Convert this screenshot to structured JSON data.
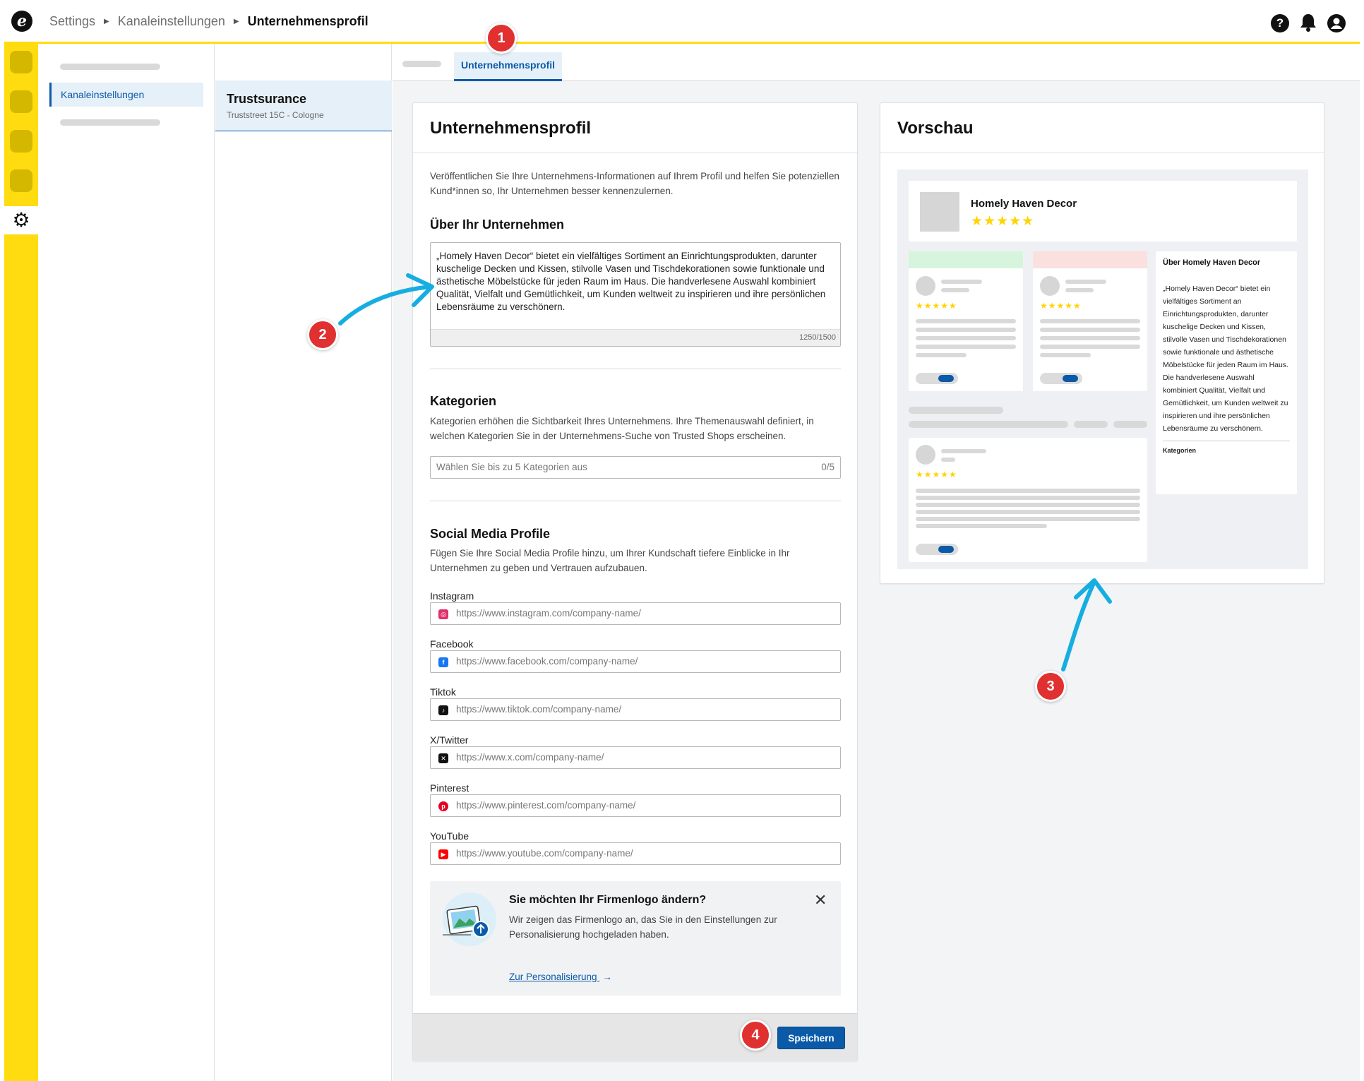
{
  "breadcrumb": {
    "root": "Settings",
    "section": "Kanaleinstellungen",
    "current": "Unternehmensprofil"
  },
  "topbar": {
    "help_icon": "question-circle-icon",
    "bell_icon": "bell-icon",
    "user_icon": "user-circle-icon"
  },
  "nav": {
    "active_item": "Kanaleinstellungen"
  },
  "channel": {
    "name": "Trustsurance",
    "address": "Truststreet 15C - Cologne"
  },
  "tabs": {
    "active": "Unternehmensprofil"
  },
  "form": {
    "title": "Unternehmensprofil",
    "intro": "Veröffentlichen Sie Ihre Unternehmens-Informationen auf Ihrem Profil und helfen Sie potenziellen Kund*innen so, Ihr Unternehmen besser kennenzulernen.",
    "about_heading": "Über Ihr Unternehmen",
    "about_text": "„Homely Haven Decor“ bietet ein vielfältiges Sortiment an Einrichtungsprodukten, darunter kuschelige Decken und Kissen, stilvolle Vasen und Tischdekorationen sowie funktionale und ästhetische Möbelstücke für jeden Raum im Haus. Die handverlesene Auswahl kombiniert Qualität, Vielfalt und Gemütlichkeit, um Kunden weltweit zu inspirieren und ihre persönlichen Lebensräume zu verschönern.",
    "about_counter": "1250/1500",
    "categories_heading": "Kategorien",
    "categories_desc": "Kategorien erhöhen die Sichtbarkeit Ihres Unternehmens. Ihre Themenauswahl definiert, in welchen Kategorien Sie in der Unternehmens-Suche von Trusted Shops erscheinen.",
    "categories_placeholder": "Wählen Sie bis zu 5 Kategorien aus",
    "categories_counter": "0/5",
    "social_heading": "Social Media Profile",
    "social_desc": "Fügen Sie Ihre Social Media Profile hinzu, um Ihrer Kundschaft tiefere Einblicke in Ihr Unternehmen zu geben und Vertrauen aufzubauen.",
    "social": [
      {
        "label": "Instagram",
        "placeholder": "https://www.instagram.com/company-name/",
        "icon": "instagram-icon",
        "color": "#e1306c"
      },
      {
        "label": "Facebook",
        "placeholder": "https://www.facebook.com/company-name/",
        "icon": "facebook-icon",
        "color": "#1877f2"
      },
      {
        "label": "Tiktok",
        "placeholder": "https://www.tiktok.com/company-name/",
        "icon": "tiktok-icon",
        "color": "#111111"
      },
      {
        "label": "X/Twitter",
        "placeholder": "https://www.x.com/company-name/",
        "icon": "x-icon",
        "color": "#111111"
      },
      {
        "label": "Pinterest",
        "placeholder": "https://www.pinterest.com/company-name/",
        "icon": "pinterest-icon",
        "color": "#e60023"
      },
      {
        "label": "YouTube",
        "placeholder": "https://www.youtube.com/company-name/",
        "icon": "youtube-icon",
        "color": "#ff0000"
      }
    ],
    "logo_banner": {
      "title": "Sie möchten Ihr Firmenlogo ändern?",
      "text": "Wir zeigen das Firmenlogo an, das Sie in den Einstellungen zur Personalisierung hochgeladen haben.",
      "link": "Zur Personalisierung"
    },
    "save_label": "Speichern"
  },
  "preview": {
    "title": "Vorschau",
    "company_name": "Homely Haven Decor",
    "stars": "★★★★★",
    "small_stars": "★★★★★",
    "about_title": "Über Homely Haven Decor",
    "about_text": "„Homely Haven Decor“ bietet ein vielfältiges Sortiment an Einrichtungsprodukten, darunter kuschelige Decken und Kissen, stilvolle Vasen und Tischdekorationen sowie funktionale und ästhetische Möbelstücke für jeden Raum im Haus. Die handverlesene Auswahl kombiniert Qualität, Vielfalt und Gemütlichkeit, um Kunden weltweit zu inspirieren und ihre persönlichen Lebensräume zu verschönern.",
    "categories_label": "Kategorien"
  },
  "callouts": [
    "1",
    "2",
    "3",
    "4"
  ],
  "colors": {
    "accent_yellow": "#ffdc0f",
    "primary_blue": "#0a5aa8",
    "callout_red": "#e03030",
    "arrow_cyan": "#16aee0"
  }
}
